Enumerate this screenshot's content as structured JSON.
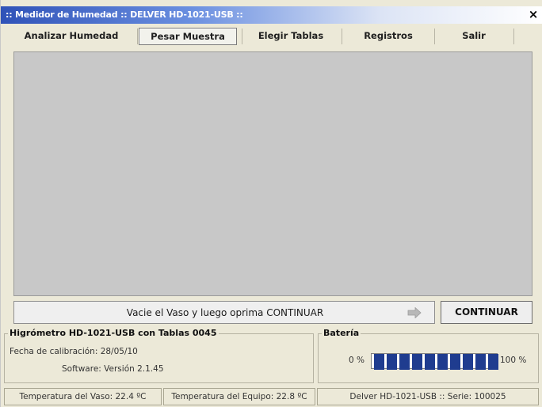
{
  "window": {
    "title": ":: Medidor de Humedad :: DELVER HD-1021-USB ::",
    "close_label": "×"
  },
  "menu": {
    "items": [
      {
        "label": "Analizar Humedad"
      },
      {
        "label": "Pesar Muestra",
        "active": true
      },
      {
        "label": "Elegir Tablas"
      },
      {
        "label": "Registros"
      },
      {
        "label": "Salir"
      }
    ]
  },
  "instruction": {
    "text": "Vacie el Vaso y luego oprima CONTINUAR",
    "arrow_icon": "right-arrow-icon"
  },
  "continue_button": {
    "label": "CONTINUAR"
  },
  "device_group": {
    "title": "Higrómetro HD-1021-USB con Tablas  0045",
    "calibration": "Fecha de calibración: 28/05/10",
    "software": "Software: Versión 2.1.45"
  },
  "battery_group": {
    "title": "Batería",
    "min_label": "0 %",
    "max_label": "100 %",
    "level_fraction": 1.0,
    "segments": 10,
    "bar_color": "#1f3c8f"
  },
  "status": {
    "vessel_temp": "Temperatura del Vaso: 22.4 ºC",
    "device_temp": "Temperatura del Equipo: 22.8 ºC",
    "serial": "Delver HD-1021-USB :: Serie: 100025"
  }
}
